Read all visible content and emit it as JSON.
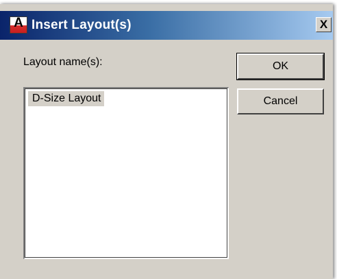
{
  "dialog": {
    "title": "Insert Layout(s)",
    "app_icon_letter": "A",
    "close_glyph": "X"
  },
  "form": {
    "layout_label": "Layout name(s):",
    "layouts": [
      "D-Size Layout"
    ]
  },
  "buttons": {
    "ok_label": "OK",
    "cancel_label": "Cancel"
  },
  "colors": {
    "dialog_face": "#d4d0c8",
    "title_gradient_start": "#0a246a",
    "title_gradient_end": "#a6caf0"
  }
}
